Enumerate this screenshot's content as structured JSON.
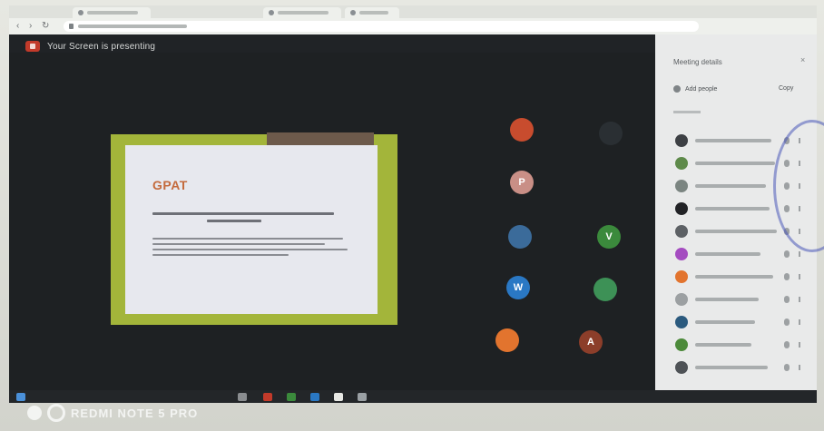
{
  "browser": {
    "tabs_count": 3
  },
  "meeting": {
    "presenting_banner": "Your Screen is presenting",
    "slide": {
      "title": "GPAT"
    },
    "participant_avatars": [
      {
        "letter": "",
        "color": "#c84c2e"
      },
      {
        "letter": "",
        "color": "#2a2f33"
      },
      {
        "letter": "P",
        "color": "#c98f86"
      },
      {
        "letter": "",
        "color": "#3b6b9a"
      },
      {
        "letter": "V",
        "color": "#3b8a3c"
      },
      {
        "letter": "W",
        "color": "#2a78c4"
      },
      {
        "letter": "",
        "color": "#3d9156"
      },
      {
        "letter": "",
        "color": "#e2742e"
      },
      {
        "letter": "A",
        "color": "#8c3e2a"
      }
    ]
  },
  "panel": {
    "title": "Meeting details",
    "add_people": "Add people",
    "copy": "Copy",
    "participants": [
      {
        "color": "#3d4044"
      },
      {
        "color": "#5e8a4a"
      },
      {
        "color": "#7b8581"
      },
      {
        "color": "#222326"
      },
      {
        "color": "#5d6165"
      },
      {
        "color": "#a44cc0"
      },
      {
        "color": "#e2742e"
      },
      {
        "color": "#9ca0a2"
      },
      {
        "color": "#2b5a7e"
      },
      {
        "color": "#4c8a3a"
      },
      {
        "color": "#4e5256"
      }
    ]
  },
  "watermark": {
    "text": "REDMI NOTE 5 PRO"
  }
}
